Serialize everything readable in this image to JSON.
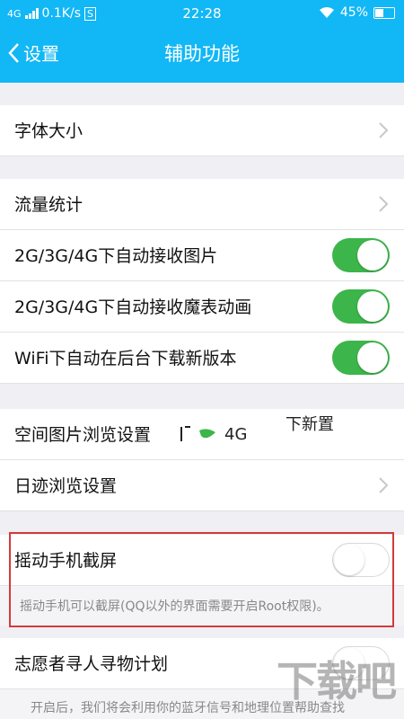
{
  "status": {
    "network": "4G",
    "speed": "0.1K/s",
    "time": "22:28",
    "battery": "45%"
  },
  "nav": {
    "back_label": "设置",
    "title": "辅助功能"
  },
  "rows": [
    {
      "label": "字体大小",
      "type": "arrow"
    },
    {
      "label": "流量统计",
      "type": "arrow"
    },
    {
      "label": "2G/3G/4G下自动接收图片",
      "type": "toggle",
      "on": true
    },
    {
      "label": "2G/3G/4G下自动接收魔表动画",
      "type": "toggle",
      "on": true
    },
    {
      "label": "WiFi下自动在后台下载新版本",
      "type": "toggle",
      "on": true
    },
    {
      "label": "空间图片浏览设置",
      "type": "plain"
    },
    {
      "label": "日迹浏览设置",
      "type": "arrow"
    },
    {
      "label": "摇动手机截屏",
      "type": "toggle",
      "on": false
    },
    {
      "label": "志愿者寻人寻物计划",
      "type": "toggle",
      "on": false
    }
  ],
  "overlay": {
    "top_text": "下新置",
    "mid_text": "4G"
  },
  "notes": {
    "shake_note": "摇动手机可以截屏(QQ以外的界面需要开启Root权限)。",
    "volunteer_note": "开启后，我们将会利用你的蓝牙信号和地理位置帮助查找"
  },
  "colors": {
    "header": "#12b7f5",
    "toggle_on": "#3cb54a",
    "highlight": "#d23b3b"
  }
}
